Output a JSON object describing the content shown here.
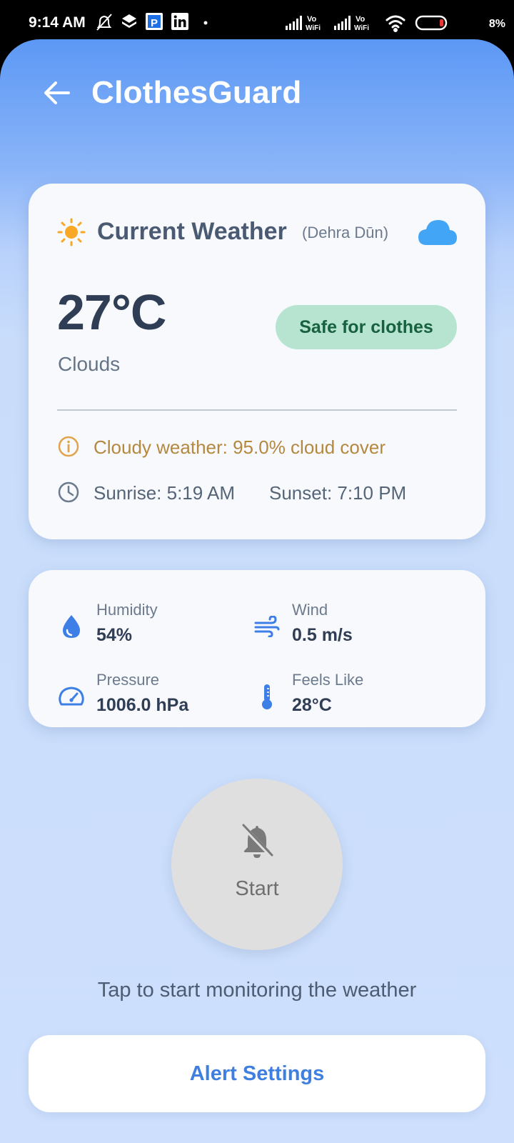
{
  "status_bar": {
    "time": "9:14 AM",
    "battery_text": "8%",
    "left_icons": [
      "mute-bell-icon",
      "layers-icon",
      "p-app-icon",
      "linkedin-icon",
      "dot-icon"
    ],
    "right_icons": [
      "signal-icon",
      "vowifi-icon",
      "signal-icon",
      "vowifi-icon",
      "wifi-icon",
      "battery-icon"
    ],
    "vowifi_top": "Vo",
    "vowifi_bottom": "WiFi"
  },
  "header": {
    "title": "ClothesGuard",
    "back_icon": "arrow-left-icon"
  },
  "weather": {
    "title": "Current Weather",
    "location": "(Dehra Dūn)",
    "temperature": "27°C",
    "condition": "Clouds",
    "badge": "Safe for clothes",
    "info": "Cloudy weather: 95.0% cloud cover",
    "sunrise": "Sunrise: 5:19 AM",
    "sunset": "Sunset: 7:10 PM",
    "colors": {
      "sun": "#f9a825",
      "cloud": "#42a5f5",
      "badge_bg": "#b6e4d0",
      "badge_text": "#17613f",
      "info_text": "#b5883f"
    }
  },
  "stats": {
    "humidity": {
      "label": "Humidity",
      "value": "54%",
      "icon": "water-drop-icon"
    },
    "wind": {
      "label": "Wind",
      "value": "0.5 m/s",
      "icon": "wind-icon"
    },
    "pressure": {
      "label": "Pressure",
      "value": "1006.0 hPa",
      "icon": "speedometer-icon"
    },
    "feels_like": {
      "label": "Feels Like",
      "value": "28°C",
      "icon": "thermometer-icon"
    }
  },
  "monitor": {
    "button_label": "Start",
    "button_icon": "bell-off-icon",
    "hint": "Tap to start monitoring the weather"
  },
  "alert_settings": {
    "label": "Alert Settings",
    "color": "#3f7fe0"
  }
}
